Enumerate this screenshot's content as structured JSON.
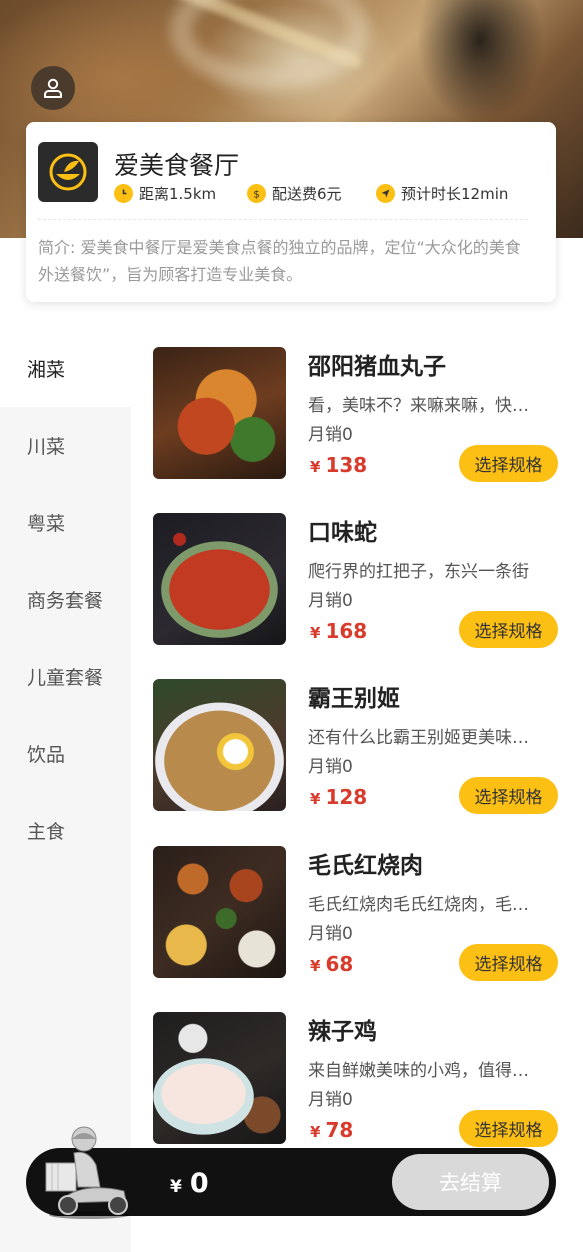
{
  "shop": {
    "name": "爱美食餐厅",
    "distance": "距离1.5km",
    "delivery_fee": "配送费6元",
    "eta": "预计时长12min",
    "intro": "简介: 爱美食中餐厅是爱美食点餐的独立的品牌，定位“大众化的美食外送餐饮”，旨为顾客打造专业美食。"
  },
  "icons": {
    "user": "user-icon",
    "logo": "bowl-leaf-logo",
    "distance": "clock-icon",
    "fee": "money-bag-icon",
    "eta": "navigation-arrow-icon"
  },
  "colors": {
    "accent": "#fcbf13",
    "price": "#d83a2c",
    "cart_bar": "#111111",
    "checkout_disabled": "#d9d9d9"
  },
  "categories": [
    {
      "label": "湘菜",
      "active": true
    },
    {
      "label": "川菜",
      "active": false
    },
    {
      "label": "粤菜",
      "active": false
    },
    {
      "label": "商务套餐",
      "active": false
    },
    {
      "label": "儿童套餐",
      "active": false
    },
    {
      "label": "饮品",
      "active": false
    },
    {
      "label": "主食",
      "active": false
    }
  ],
  "dishes": [
    {
      "name": "邵阳猪血丸子",
      "desc": "看，美味不？来嘛来嘛，快来尝尝",
      "sales": "月销0",
      "currency": "¥",
      "price": "138",
      "button": "选择规格"
    },
    {
      "name": "口味蛇",
      "desc": "爬行界的扛把子，东兴一条街",
      "sales": "月销0",
      "currency": "¥",
      "price": "168",
      "button": "选择规格"
    },
    {
      "name": "霸王别姬",
      "desc": "还有什么比霸王别姬更美味的呢",
      "sales": "月销0",
      "currency": "¥",
      "price": "128",
      "button": "选择规格"
    },
    {
      "name": "毛氏红烧肉",
      "desc": "毛氏红烧肉毛氏红烧肉，毛氏红烧肉",
      "sales": "月销0",
      "currency": "¥",
      "price": "68",
      "button": "选择规格"
    },
    {
      "name": "辣子鸡",
      "desc": "来自鲜嫩美味的小鸡，值得一尝",
      "sales": "月销0",
      "currency": "¥",
      "price": "78",
      "button": "选择规格"
    }
  ],
  "cart": {
    "currency": "¥",
    "total": "0",
    "checkout_label": "去结算"
  }
}
